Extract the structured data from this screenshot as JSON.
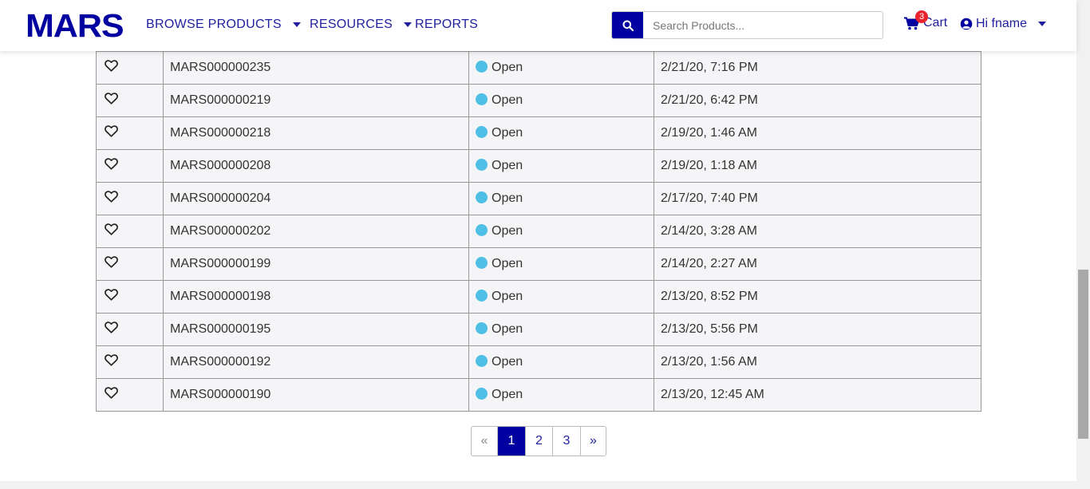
{
  "brand": {
    "logo": "MARS"
  },
  "nav": {
    "browse_products": "BROWSE PRODUCTS",
    "resources": "RESOURCES",
    "reports": "REPORTS"
  },
  "search": {
    "placeholder": "Search Products..."
  },
  "cart": {
    "label": "Cart",
    "count": "3"
  },
  "user": {
    "greeting": "Hi fname"
  },
  "orders": [
    {
      "id": "MARS000000235",
      "status": "Open",
      "date": "2/21/20, 7:16 PM"
    },
    {
      "id": "MARS000000219",
      "status": "Open",
      "date": "2/21/20, 6:42 PM"
    },
    {
      "id": "MARS000000218",
      "status": "Open",
      "date": "2/19/20, 1:46 AM"
    },
    {
      "id": "MARS000000208",
      "status": "Open",
      "date": "2/19/20, 1:18 AM"
    },
    {
      "id": "MARS000000204",
      "status": "Open",
      "date": "2/17/20, 7:40 PM"
    },
    {
      "id": "MARS000000202",
      "status": "Open",
      "date": "2/14/20, 3:28 AM"
    },
    {
      "id": "MARS000000199",
      "status": "Open",
      "date": "2/14/20, 2:27 AM"
    },
    {
      "id": "MARS000000198",
      "status": "Open",
      "date": "2/13/20, 8:52 PM"
    },
    {
      "id": "MARS000000195",
      "status": "Open",
      "date": "2/13/20, 5:56 PM"
    },
    {
      "id": "MARS000000192",
      "status": "Open",
      "date": "2/13/20, 1:56 AM"
    },
    {
      "id": "MARS000000190",
      "status": "Open",
      "date": "2/13/20, 12:45 AM"
    }
  ],
  "pagination": {
    "prev": "«",
    "pages": [
      "1",
      "2",
      "3"
    ],
    "active": "1",
    "next": "»"
  },
  "colors": {
    "brand": "#0000a0",
    "status_open": "#4fbfe6",
    "badge": "#e8232e"
  }
}
